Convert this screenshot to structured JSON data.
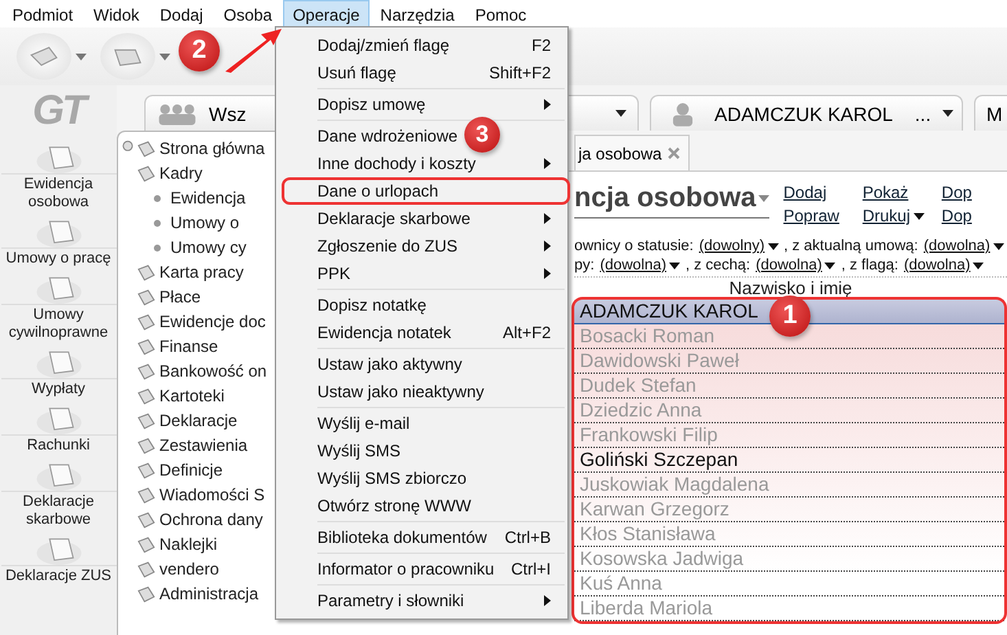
{
  "menubar": [
    {
      "label": "Podmiot",
      "selected": false
    },
    {
      "label": "Widok",
      "selected": false
    },
    {
      "label": "Dodaj",
      "selected": false
    },
    {
      "label": "Osoba",
      "selected": false
    },
    {
      "label": "Operacje",
      "selected": true
    },
    {
      "label": "Narzędzia",
      "selected": false
    },
    {
      "label": "Pomoc",
      "selected": false
    }
  ],
  "logo": "GT",
  "nav": [
    {
      "label": "Ewidencja osobowa"
    },
    {
      "label": "Umowy o pracę"
    },
    {
      "label": "Umowy cywilnoprawne"
    },
    {
      "label": "Wypłaty"
    },
    {
      "label": "Rachunki"
    },
    {
      "label": "Deklaracje skarbowe"
    },
    {
      "label": "Deklaracje ZUS"
    }
  ],
  "tabs": [
    {
      "label": "Wsz",
      "kind": "group"
    },
    {
      "label": "ADAMCZUK KAROL",
      "kind": "person",
      "more": "..."
    },
    {
      "label": "M",
      "kind": "plain"
    }
  ],
  "tree": [
    {
      "label": "Strona główna"
    },
    {
      "label": "Kadry",
      "children": [
        {
          "label": "Ewidencja"
        },
        {
          "label": "Umowy o"
        },
        {
          "label": "Umowy cy"
        }
      ]
    },
    {
      "label": "Karta pracy"
    },
    {
      "label": "Płace"
    },
    {
      "label": "Ewidencje doc"
    },
    {
      "label": "Finanse"
    },
    {
      "label": "Bankowość on"
    },
    {
      "label": "Kartoteki"
    },
    {
      "label": "Deklaracje"
    },
    {
      "label": "Zestawienia"
    },
    {
      "label": "Definicje"
    },
    {
      "label": "Wiadomości S"
    },
    {
      "label": "Ochrona dany"
    },
    {
      "label": "Naklejki"
    },
    {
      "label": "vendero"
    },
    {
      "label": "Administracja"
    }
  ],
  "subtab": {
    "label": "ja osobowa"
  },
  "title": "ncja osobowa",
  "links": [
    [
      "Dodaj",
      "Popraw"
    ],
    [
      "Pokaż",
      "Drukuj"
    ],
    [
      "Dop",
      "Dop"
    ]
  ],
  "filters": [
    [
      {
        "text": "ownicy o statusie:"
      },
      {
        "value": "(dowolny)"
      },
      {
        "text": ", z aktualną umową:"
      },
      {
        "value": "(dowolna)"
      }
    ],
    [
      {
        "text": "py:"
      },
      {
        "value": "(dowolna)"
      },
      {
        "text": ", z cechą:"
      },
      {
        "value": "(dowolna)"
      },
      {
        "text": ", z flagą:"
      },
      {
        "value": "(dowolna)"
      }
    ]
  ],
  "list": {
    "column": "Nazwisko i imię",
    "highlighted": true,
    "rows": [
      {
        "name": "ADAMCZUK KAROL",
        "selected": true,
        "inactive": false
      },
      {
        "name": "Bosacki Roman",
        "selected": false,
        "inactive": true
      },
      {
        "name": "Dawidowski Paweł",
        "selected": false,
        "inactive": true
      },
      {
        "name": "Dudek Stefan",
        "selected": false,
        "inactive": true
      },
      {
        "name": "Dziedzic Anna",
        "selected": false,
        "inactive": true
      },
      {
        "name": "Frankowski Filip",
        "selected": false,
        "inactive": true
      },
      {
        "name": "Goliński Szczepan",
        "selected": false,
        "inactive": false
      },
      {
        "name": "Juskowiak Magdalena",
        "selected": false,
        "inactive": true
      },
      {
        "name": "Karwan Grzegorz",
        "selected": false,
        "inactive": true
      },
      {
        "name": "Kłos Stanisława",
        "selected": false,
        "inactive": true
      },
      {
        "name": "Kosowska Jadwiga",
        "selected": false,
        "inactive": true
      },
      {
        "name": "Kuś Anna",
        "selected": false,
        "inactive": true
      },
      {
        "name": "Liberda Mariola",
        "selected": false,
        "inactive": true
      }
    ]
  },
  "menu": {
    "groups": [
      [
        {
          "label": "Dodaj/zmień flagę",
          "shortcut": "F2"
        },
        {
          "label": "Usuń flagę",
          "shortcut": "Shift+F2"
        }
      ],
      [
        {
          "label": "Dopisz umowę",
          "submenu": true
        }
      ],
      [
        {
          "label": "Dane wdrożeniowe"
        },
        {
          "label": "Inne dochody i koszty",
          "submenu": true
        },
        {
          "label": "Dane o urlopach",
          "highlighted": true
        },
        {
          "label": "Deklaracje skarbowe",
          "submenu": true
        },
        {
          "label": "Zgłoszenie do ZUS",
          "submenu": true
        },
        {
          "label": "PPK",
          "submenu": true
        }
      ],
      [
        {
          "label": "Dopisz notatkę"
        },
        {
          "label": "Ewidencja notatek",
          "shortcut": "Alt+F2"
        }
      ],
      [
        {
          "label": "Ustaw jako aktywny"
        },
        {
          "label": "Ustaw jako nieaktywny"
        }
      ],
      [
        {
          "label": "Wyślij e-mail"
        },
        {
          "label": "Wyślij SMS"
        },
        {
          "label": "Wyślij SMS zbiorczo"
        },
        {
          "label": "Otwórz stronę WWW"
        }
      ],
      [
        {
          "label": "Biblioteka dokumentów",
          "shortcut": "Ctrl+B"
        }
      ],
      [
        {
          "label": "Informator o pracowniku",
          "shortcut": "Ctrl+I"
        }
      ],
      [
        {
          "label": "Parametry i słowniki",
          "submenu": true
        }
      ]
    ]
  },
  "callouts": [
    "1",
    "2",
    "3"
  ]
}
